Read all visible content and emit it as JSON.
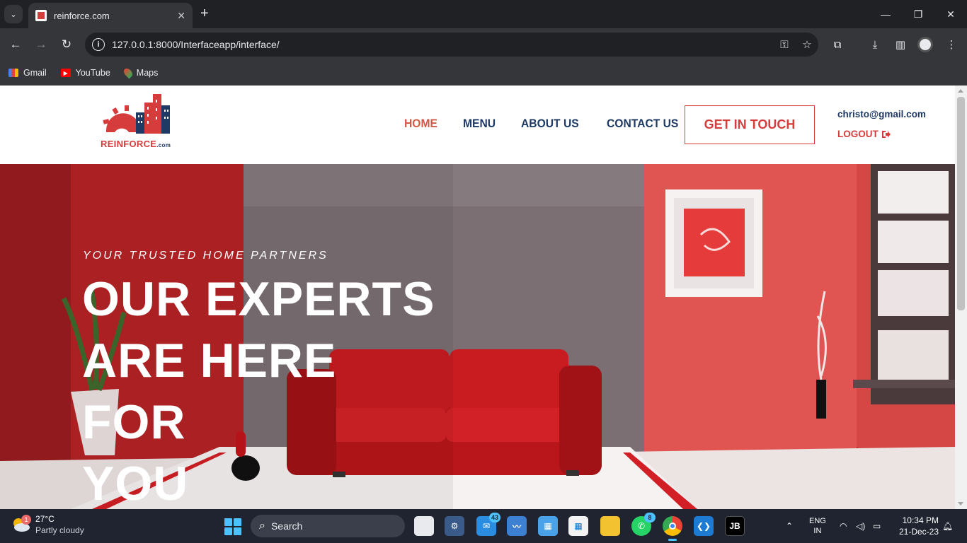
{
  "browser": {
    "tab_title": "reinforce.com",
    "url": "127.0.0.1:8000/Interfaceapp/interface/",
    "bookmarks": [
      {
        "label": "Gmail",
        "icon": "gmail-icon"
      },
      {
        "label": "YouTube",
        "icon": "youtube-icon"
      },
      {
        "label": "Maps",
        "icon": "maps-icon"
      }
    ]
  },
  "site": {
    "logo": {
      "name": "REINFORCE",
      "suffix": ".com"
    },
    "nav": [
      "HOME",
      "MENU",
      "ABOUT US",
      "CONTACT US"
    ],
    "active_nav": "HOME",
    "cta": "GET IN TOUCH",
    "user_email": "christo@gmail.com",
    "logout": "LOGOUT",
    "hero": {
      "subtitle": "YOUR TRUSTED HOME PARTNERS",
      "title_lines": [
        "OUR EXPERTS",
        "ARE HERE FOR",
        "YOU"
      ]
    }
  },
  "taskbar": {
    "weather_temp": "27°C",
    "weather_desc": "Partly cloudy",
    "weather_badge": "1",
    "search_placeholder": "Search",
    "mail_badge": "43",
    "whatsapp_badge": "8",
    "jb_label": "JB",
    "lang_top": "ENG",
    "lang_bottom": "IN",
    "time": "10:34 PM",
    "date": "21-Dec-23"
  },
  "colors": {
    "brand_red": "#d63c3c",
    "brand_navy": "#1f3a64",
    "active_nav": "#d35a48"
  }
}
